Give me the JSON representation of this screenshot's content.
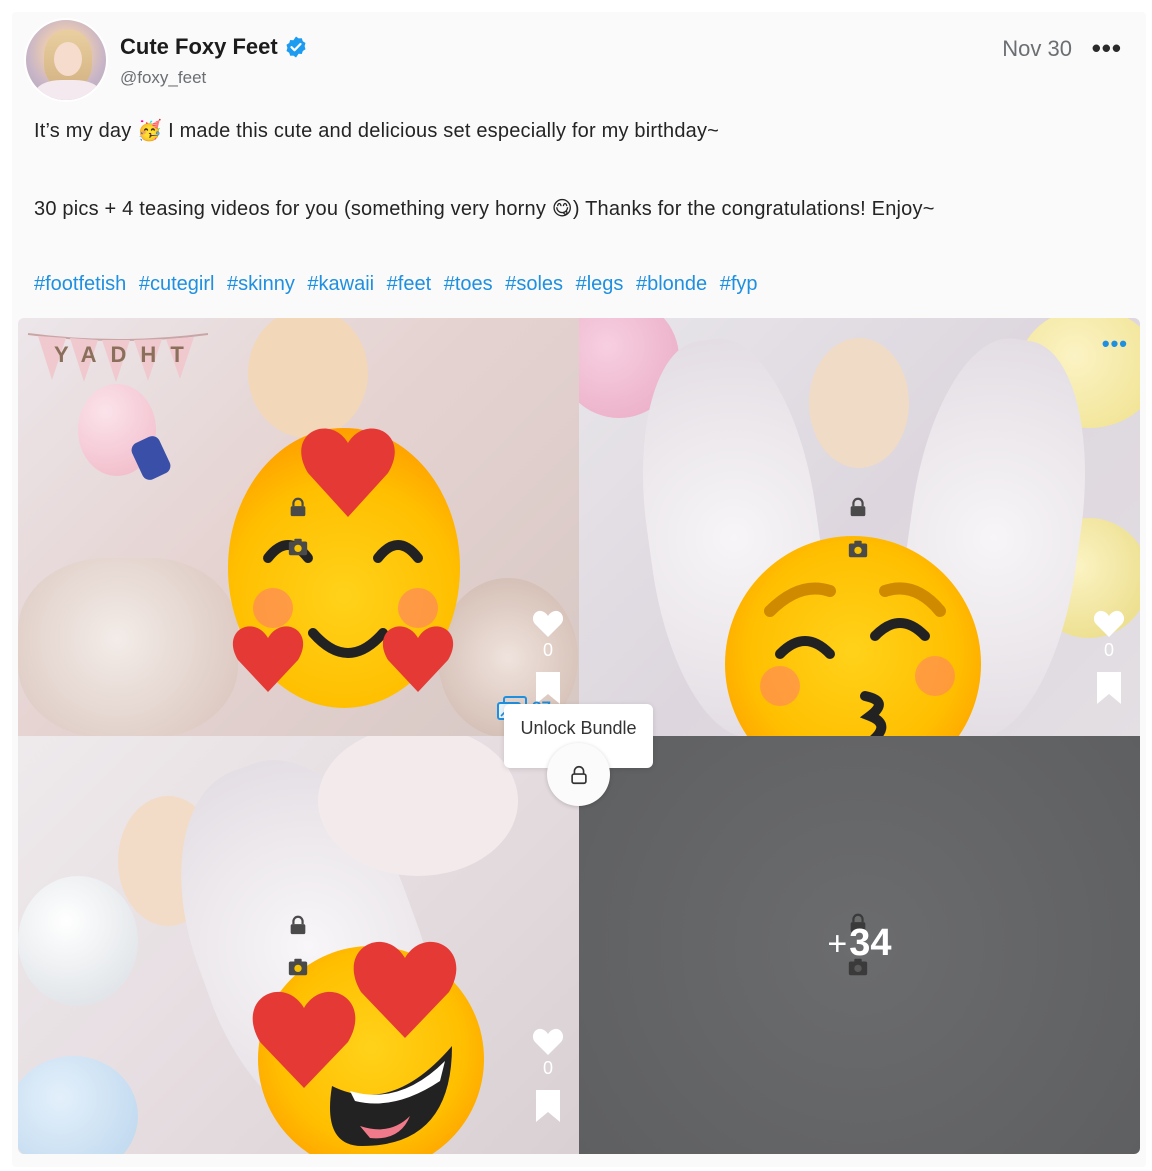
{
  "post": {
    "author_name": "Cute Foxy Feet",
    "handle": "@foxy_feet",
    "date": "Nov 30",
    "more_icon": "ellipsis-icon",
    "line1_a": "It’s my day",
    "line1_emoji": "🥳",
    "line1_b": "I made this cute and delicious set especially for my birthday~",
    "line2_a": "30 pics + 4 teasing videos for you (something very horny",
    "line2_emoji": "😋",
    "line2_b": ") Thanks for the congratulations! Enjoy~",
    "hashtags": [
      "#footfetish",
      "#cutegirl",
      "#skinny",
      "#kawaii",
      "#feet",
      "#toes",
      "#soles",
      "#legs",
      "#blonde",
      "#fyp"
    ]
  },
  "media": {
    "tiles": [
      {
        "likes": "0",
        "emoji": "🥰"
      },
      {
        "likes": "0",
        "emoji": "😚"
      },
      {
        "likes": "0",
        "emoji": "😍"
      },
      {
        "overlay_plus": "+",
        "overlay_count": "34"
      }
    ],
    "banner_text": "YADHT",
    "bundle_count": "37",
    "tooltip": "Unlock Bundle"
  },
  "colors": {
    "accent": "#1f8fe0",
    "verified": "#1d9bf0"
  }
}
